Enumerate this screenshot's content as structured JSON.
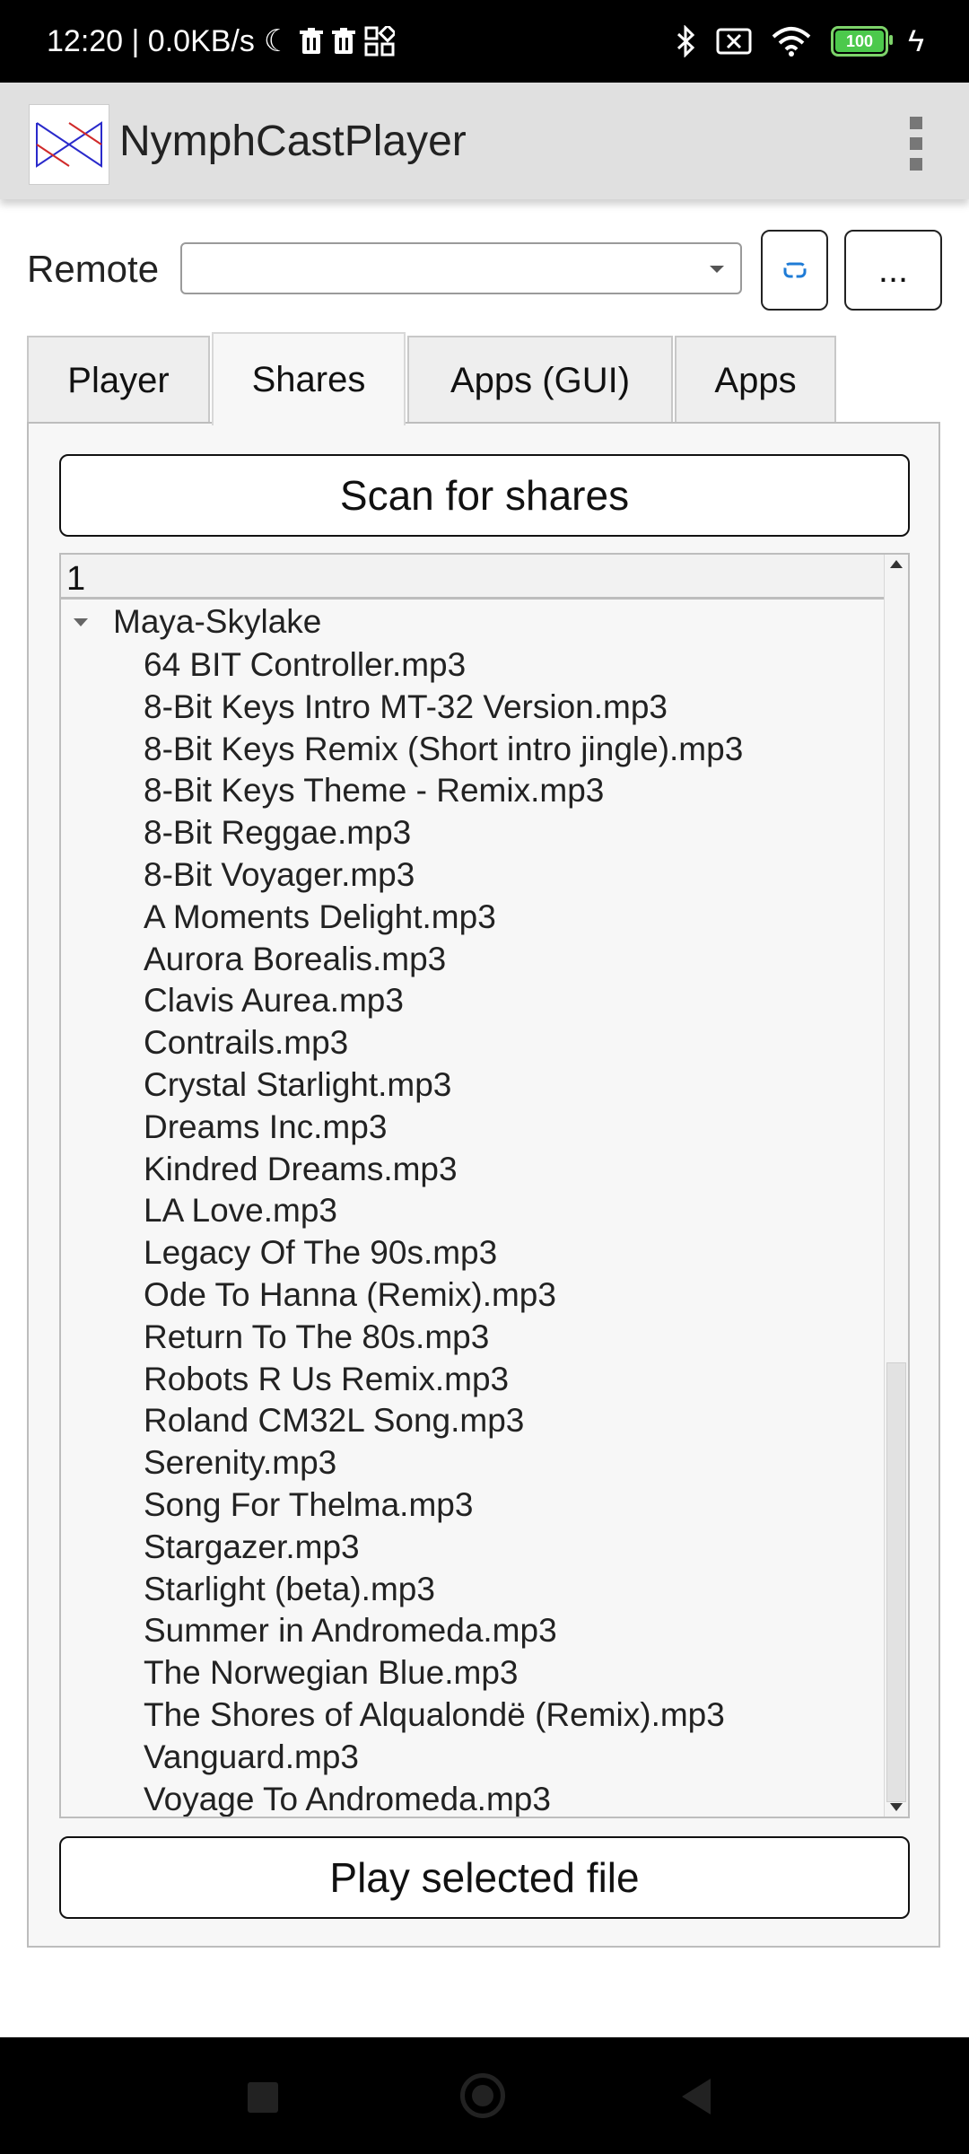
{
  "status_bar": {
    "time_speed": "12:20 | 0.0KB/s",
    "battery_level": "100"
  },
  "app_bar": {
    "title": "NymphCastPlayer"
  },
  "remote": {
    "label": "Remote",
    "selected_value": "",
    "more_label": "..."
  },
  "tabs": [
    {
      "label": "Player"
    },
    {
      "label": "Shares"
    },
    {
      "label": "Apps (GUI)"
    },
    {
      "label": "Apps"
    }
  ],
  "active_tab": "Shares",
  "shares": {
    "scan_label": "Scan for shares",
    "tree_header": "1",
    "root_node": "Maya-Skylake",
    "files": [
      "64 BIT Controller.mp3",
      "8-Bit Keys Intro MT-32 Version.mp3",
      "8-Bit Keys Remix (Short intro jingle).mp3",
      "8-Bit Keys Theme - Remix.mp3",
      "8-Bit Reggae.mp3",
      "8-Bit Voyager.mp3",
      "A Moments Delight.mp3",
      "Aurora Borealis.mp3",
      "Clavis Aurea.mp3",
      "Contrails.mp3",
      "Crystal Starlight.mp3",
      "Dreams Inc.mp3",
      "Kindred Dreams.mp3",
      "LA Love.mp3",
      "Legacy Of The 90s.mp3",
      "Ode To Hanna (Remix).mp3",
      "Return To The 80s.mp3",
      "Robots R Us Remix.mp3",
      "Roland CM32L Song.mp3",
      "Serenity.mp3",
      "Song For Thelma.mp3",
      "Stargazer.mp3",
      "Starlight (beta).mp3",
      "Summer in Andromeda.mp3",
      "The Norwegian Blue.mp3",
      "The Shores of Alqualondë (Remix).mp3",
      "Vanguard.mp3",
      "Voyage To Andromeda.mp3"
    ],
    "play_label": "Play selected file"
  },
  "colors": {
    "app_bar_bg": "#e0e0e0",
    "panel_bg": "#f7f7f7",
    "battery": "#4cc94c",
    "refresh_icon": "#1e7bd6",
    "logo_blue": "#2a2acb",
    "logo_red": "#d02a2a"
  }
}
